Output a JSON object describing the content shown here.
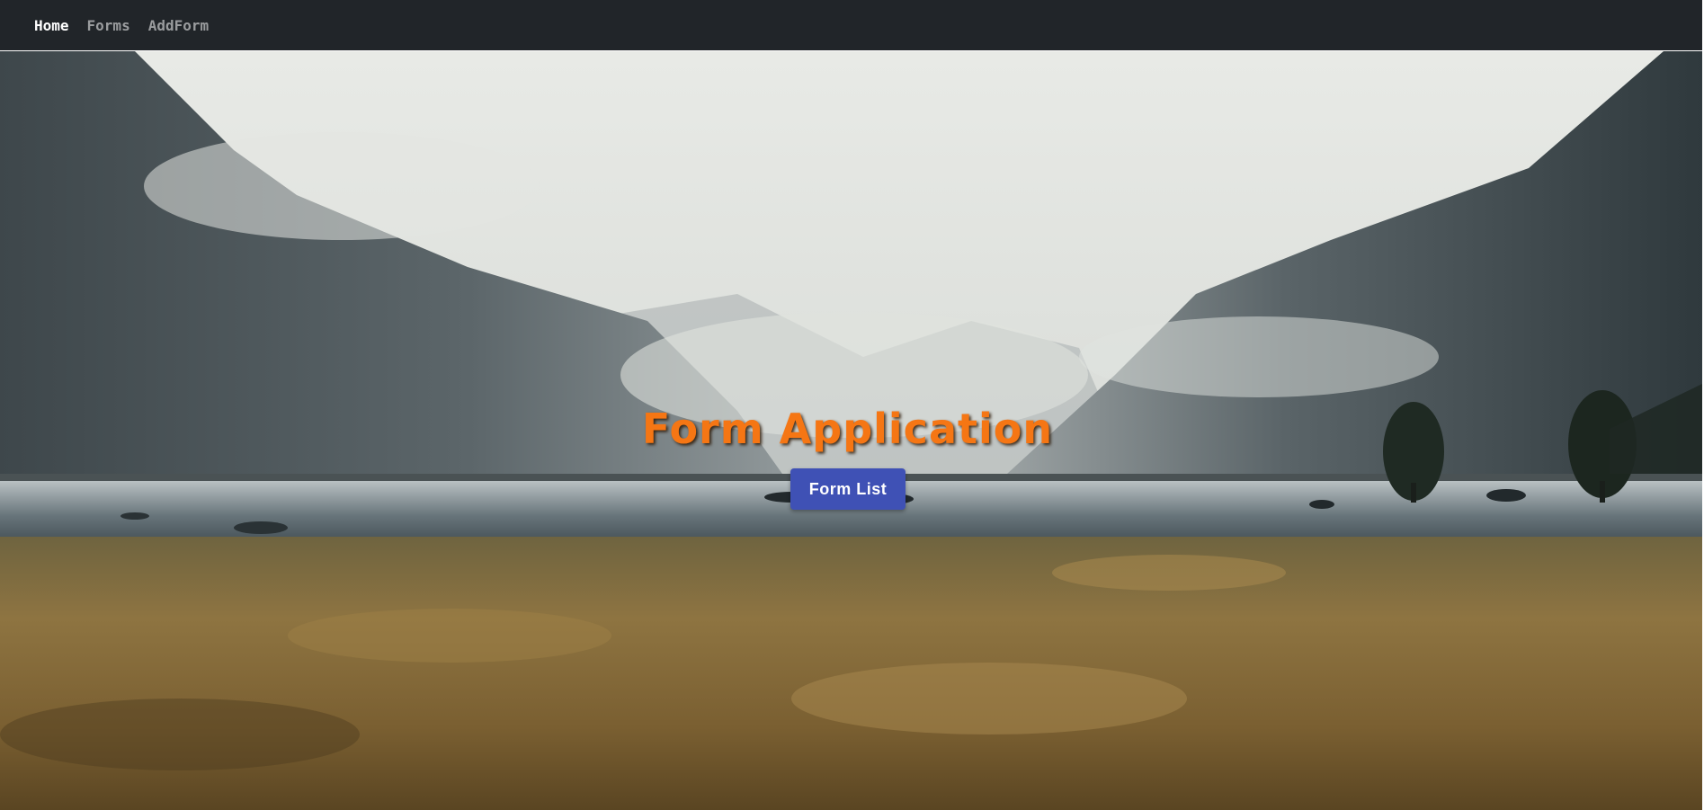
{
  "navbar": {
    "links": [
      {
        "label": "Home",
        "active": true
      },
      {
        "label": "Forms",
        "active": false
      },
      {
        "label": "AddForm",
        "active": false
      }
    ]
  },
  "hero": {
    "title": "Form Application",
    "button_label": "Form List",
    "title_color": "#f57614",
    "button_color": "#3f51b5"
  }
}
